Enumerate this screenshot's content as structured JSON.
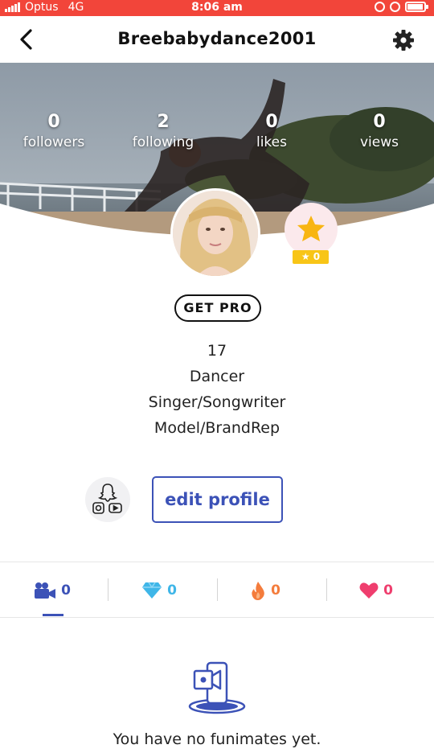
{
  "status_bar": {
    "carrier": "Optus",
    "network": "4G",
    "time": "8:06 am",
    "bg_color": "#f2453a"
  },
  "header": {
    "title": "Breebabydance2001",
    "back_icon": "chevron-left-icon",
    "settings_icon": "gear-icon"
  },
  "stats": [
    {
      "value": "0",
      "label": "followers"
    },
    {
      "value": "2",
      "label": "following"
    },
    {
      "value": "0",
      "label": "likes"
    },
    {
      "value": "0",
      "label": "views"
    }
  ],
  "star_badge": {
    "count": "★ 0",
    "color": "#f8c517"
  },
  "get_pro_label": "GET PRO",
  "bio": [
    "17",
    "Dancer",
    "Singer/Songwriter",
    "Model/BrandRep"
  ],
  "edit_profile_label": "edit profile",
  "accent_color": "#3c52b7",
  "tabs": [
    {
      "icon": "video-camera-icon",
      "count": "0",
      "color": "#3c52b7",
      "active": true
    },
    {
      "icon": "diamond-icon",
      "count": "0",
      "color": "#3fb6e8",
      "active": false
    },
    {
      "icon": "fire-icon",
      "count": "0",
      "color": "#f47c3c",
      "active": false
    },
    {
      "icon": "heart-icon",
      "count": "0",
      "color": "#ef3e6e",
      "active": false
    }
  ],
  "empty_state": {
    "message": "You have no funimates yet."
  }
}
